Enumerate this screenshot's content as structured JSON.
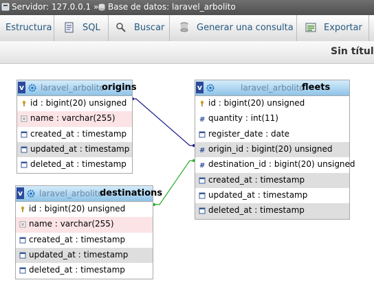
{
  "breadcrumb": {
    "server": "Servidor: 127.0.0.1 »",
    "database": "Base de datos: laravel_arbolito"
  },
  "tabs": [
    {
      "label": "Estructura",
      "icon": "structure-icon"
    },
    {
      "label": "SQL",
      "icon": "sql-icon"
    },
    {
      "label": "Buscar",
      "icon": "search-icon"
    },
    {
      "label": "Generar una consulta",
      "icon": "query-icon"
    },
    {
      "label": "Exportar",
      "icon": "export-icon"
    }
  ],
  "page_title": "Sin título",
  "tables": {
    "origins": {
      "db": "laravel_arbolito",
      "name": "origins",
      "columns": [
        {
          "text": "id : bigint(20) unsigned",
          "icon": "key-icon"
        },
        {
          "text": "name : varchar(255)",
          "icon": "text-icon"
        },
        {
          "text": "created_at : timestamp",
          "icon": "date-icon"
        },
        {
          "text": "updated_at : timestamp",
          "icon": "date-icon"
        },
        {
          "text": "deleted_at : timestamp",
          "icon": "date-icon"
        }
      ]
    },
    "destinations": {
      "db": "laravel_arbolito",
      "name": "destinations",
      "columns": [
        {
          "text": "id : bigint(20) unsigned",
          "icon": "key-icon"
        },
        {
          "text": "name : varchar(255)",
          "icon": "text-icon"
        },
        {
          "text": "created_at : timestamp",
          "icon": "date-icon"
        },
        {
          "text": "updated_at : timestamp",
          "icon": "date-icon"
        },
        {
          "text": "deleted_at : timestamp",
          "icon": "date-icon"
        }
      ]
    },
    "fleets": {
      "db": "laravel_arbolito",
      "name": "fleets",
      "columns": [
        {
          "text": "id : bigint(20) unsigned",
          "icon": "key-icon"
        },
        {
          "text": "quantity : int(11)",
          "icon": "number-icon"
        },
        {
          "text": "register_date : date",
          "icon": "date-icon"
        },
        {
          "text": "origin_id : bigint(20) unsigned",
          "icon": "number-icon"
        },
        {
          "text": "destination_id : bigint(20) unsigned",
          "icon": "number-icon"
        },
        {
          "text": "created_at : timestamp",
          "icon": "date-icon"
        },
        {
          "text": "updated_at : timestamp",
          "icon": "date-icon"
        },
        {
          "text": "deleted_at : timestamp",
          "icon": "date-icon"
        }
      ]
    }
  },
  "relations": [
    {
      "from": "origins.id",
      "to": "fleets.origin_id",
      "color": "#1a1a8c"
    },
    {
      "from": "destinations.id",
      "to": "fleets.destination_id",
      "color": "#22aa22"
    }
  ],
  "colors": {
    "toggle": "#2d4a9b",
    "header_db": "#6b8aa4",
    "name_row": "#fbe3e6",
    "alt_row": "#dedede"
  }
}
